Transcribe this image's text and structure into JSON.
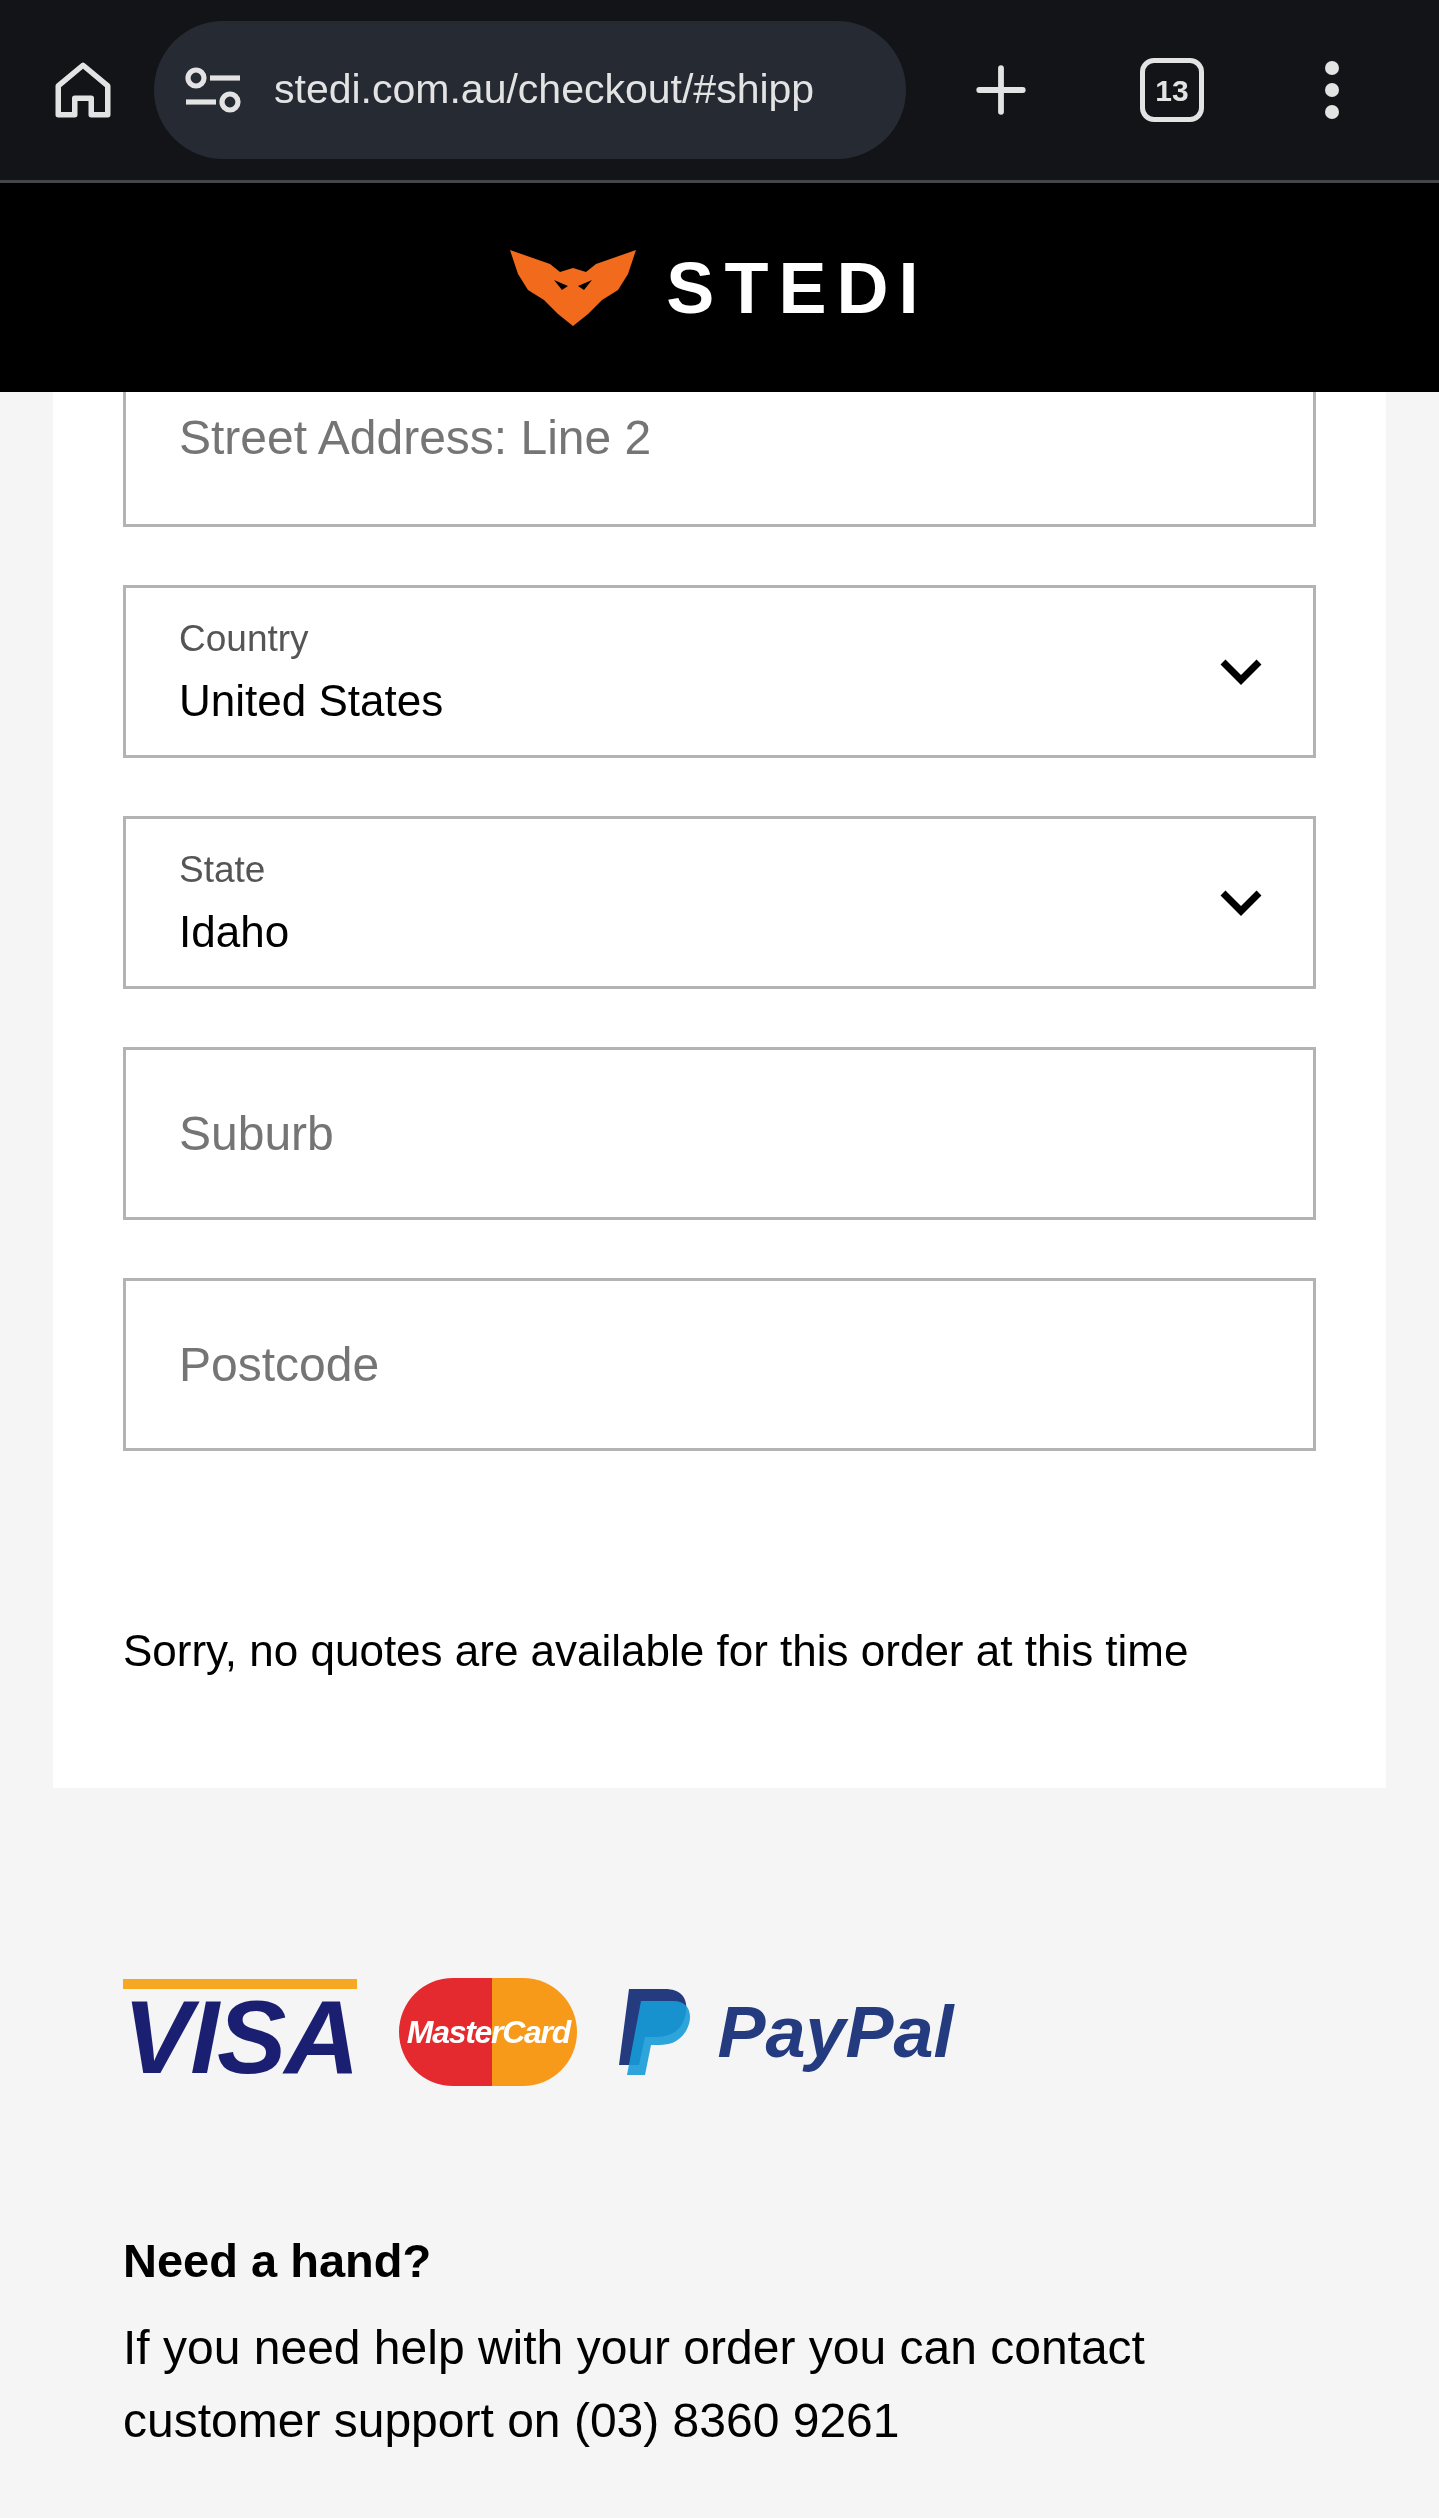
{
  "browser": {
    "url": "stedi.com.au/checkout/#shipp",
    "tab_count": "13"
  },
  "header": {
    "logo_text": "STEDI"
  },
  "fields": [
    {
      "kind": "text",
      "placeholder": "Street Address: Line 2",
      "cut": true
    },
    {
      "kind": "select",
      "label": "Country",
      "value": "United States"
    },
    {
      "kind": "select",
      "label": "State",
      "value": "Idaho"
    },
    {
      "kind": "text",
      "placeholder": "Suburb"
    },
    {
      "kind": "text",
      "placeholder": "Postcode"
    }
  ],
  "shipping_message": "Sorry, no quotes are available for this order at this time",
  "payment_logos": [
    {
      "kind": "visa",
      "text": "VISA"
    },
    {
      "kind": "mastercard",
      "text": "MasterCard"
    },
    {
      "kind": "paypal",
      "text": "PayPal"
    }
  ],
  "help": {
    "title": "Need a hand?",
    "text": "If you need help with your order you can contact customer support on (03) 8360 9261"
  }
}
